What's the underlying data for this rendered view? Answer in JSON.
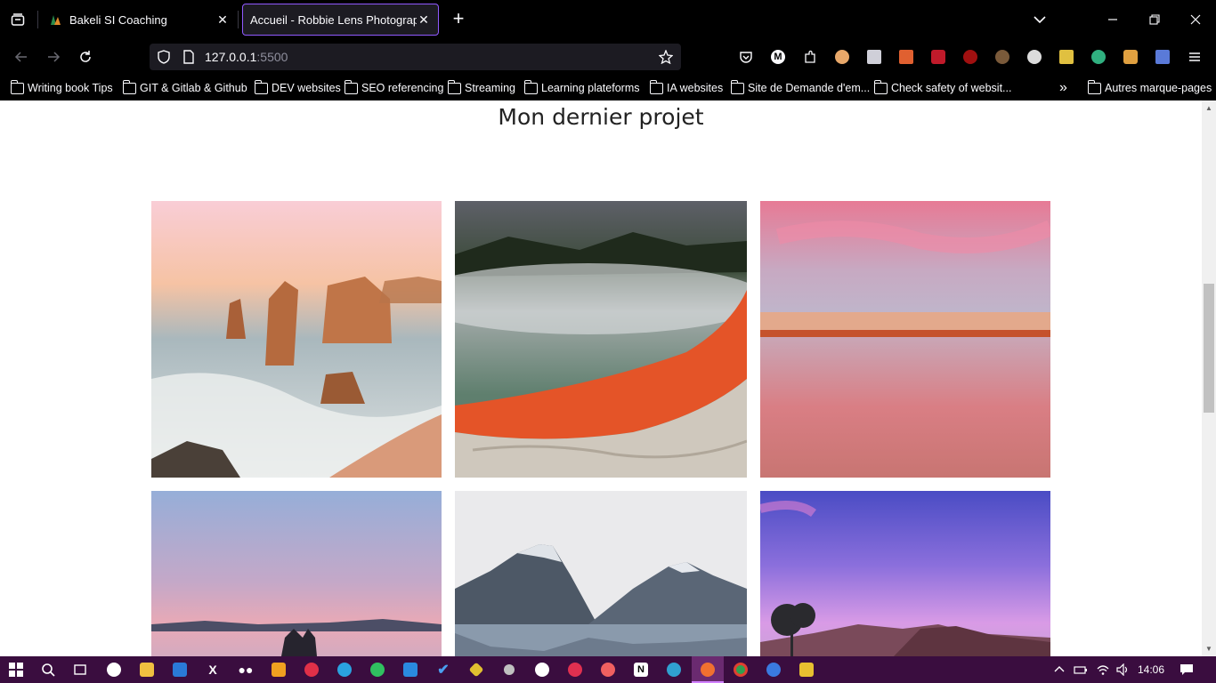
{
  "browser": {
    "tabs": [
      {
        "title": "Bakeli SI Coaching",
        "active": false
      },
      {
        "title": "Accueil - Robbie Lens Photographie",
        "active": true
      }
    ],
    "url": {
      "host": "127.0.0.1",
      "port": ":5500"
    },
    "bookmarks": [
      "Writing book Tips",
      "GIT & Gitlab & Github",
      "DEV websites",
      "SEO referencing",
      "Streaming",
      "Learning plateforms",
      "IA websites",
      "Site de Demande d'em...",
      "Check safety of websit..."
    ],
    "other_bookmarks": "Autres marque-pages",
    "colors": {
      "accent": "#9059ff",
      "chrome_bg": "#000000",
      "urlbar_bg": "#1c1b22"
    }
  },
  "page": {
    "section_title": "Mon dernier projet",
    "photos": [
      {
        "name": "coastal-rock-stacks-sunset",
        "colors": [
          "#f7c7c9",
          "#e8b59a",
          "#c77a4e",
          "#8fa3a8"
        ]
      },
      {
        "name": "geothermal-hot-spring",
        "colors": [
          "#5c6068",
          "#7b8d88",
          "#e8562a",
          "#c9c2b6"
        ]
      },
      {
        "name": "pink-sunset-beach-reflection",
        "colors": [
          "#e57b95",
          "#c89aaf",
          "#d99070",
          "#d07080"
        ]
      },
      {
        "name": "couple-lake-dusk",
        "colors": [
          "#9cb0d8",
          "#c3a9c9",
          "#e7a8b8",
          "#c9a6c0"
        ]
      },
      {
        "name": "fjord-mountains-reflection",
        "colors": [
          "#e8e8ea",
          "#7d8b9c",
          "#4e5968",
          "#9ba8b6"
        ]
      },
      {
        "name": "purple-sky-mountains",
        "colors": [
          "#5b55c9",
          "#8a6fd8",
          "#d07fe0",
          "#6a4a6e"
        ]
      }
    ]
  },
  "taskbar": {
    "time": "14:06",
    "icons": [
      "windows-start-icon",
      "search-icon",
      "task-view-icon",
      "app-icon",
      "file-explorer-icon",
      "mail-icon",
      "x-icon",
      "medium-icon",
      "slides-icon",
      "pinterest-icon",
      "telegram-icon",
      "whatsapp-icon",
      "vscode-icon",
      "todo-icon",
      "git-kraken-icon",
      "obs-icon",
      "github-icon",
      "settings-icon",
      "figma-icon",
      "notion-icon",
      "edge-icon",
      "firefox-icon",
      "chrome-icon",
      "messenger-icon",
      "clapper-icon"
    ]
  }
}
